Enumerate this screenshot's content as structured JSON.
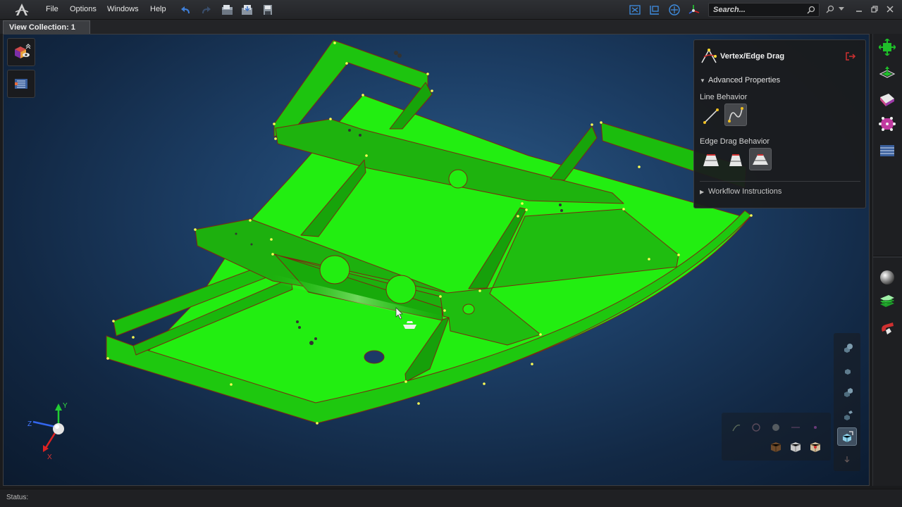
{
  "menu": {
    "items": [
      {
        "label": "File"
      },
      {
        "label": "Options"
      },
      {
        "label": "Windows"
      },
      {
        "label": "Help"
      }
    ]
  },
  "search": {
    "placeholder": "Search..."
  },
  "tab": {
    "label": "View Collection: 1"
  },
  "tool_panel": {
    "title": "Vertex/Edge Drag",
    "advanced_properties": "Advanced Properties",
    "line_behavior": "Line Behavior",
    "edge_drag_behavior": "Edge Drag Behavior",
    "workflow_instructions": "Workflow Instructions"
  },
  "triad": {
    "y_label": "Y",
    "x_label": "X",
    "z_label": "Z"
  },
  "status": {
    "label": "Status:"
  },
  "colors": {
    "model_face": "#22ee11",
    "model_edge": "#7a2a10",
    "vertex": "#ffff55",
    "viewport_center": "#2d5a88",
    "accent_green": "#22cc33"
  },
  "icons": {
    "undo": "undo-icon",
    "redo": "redo-icon",
    "open": "open-icon",
    "save": "save-icon",
    "print": "print-icon",
    "help": "help-icon"
  }
}
